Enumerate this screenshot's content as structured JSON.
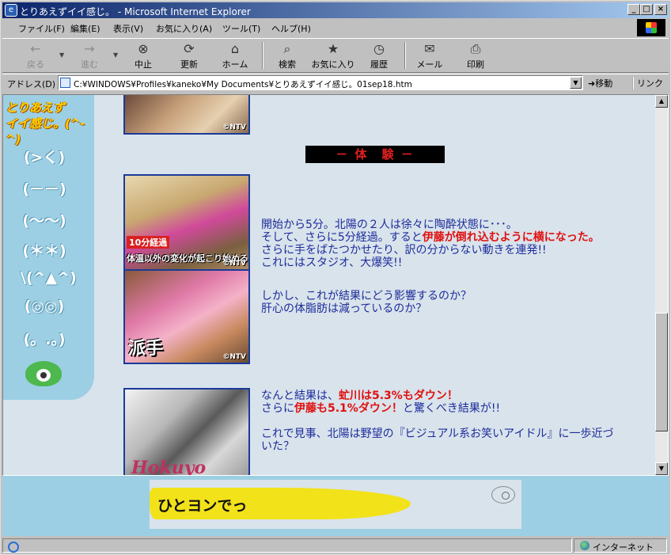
{
  "window": {
    "title": "とりあえずイイ感じ。 - Microsoft Internet Explorer",
    "controls": {
      "minimize": "_",
      "maximize": "□",
      "close": "×"
    }
  },
  "menu": [
    "ファイル(F)",
    "編集(E)",
    "表示(V)",
    "お気に入り(A)",
    "ツール(T)",
    "ヘルプ(H)"
  ],
  "toolbar": {
    "back": "戻る",
    "forward": "進む",
    "stop": "中止",
    "refresh": "更新",
    "home": "ホーム",
    "search": "検索",
    "favorites": "お気に入り",
    "history": "履歴",
    "mail": "メール",
    "print": "印刷"
  },
  "address": {
    "label": "アドレス(D)",
    "url": "C:¥WINDOWS¥Profiles¥kaneko¥My Documents¥とりあえずイイ感じ。01sep18.htm",
    "go": "移動",
    "links": "リンク"
  },
  "sidebar": {
    "logo_line1": "とりあえず",
    "logo_line2": "イイ感じ。(^-^)",
    "faces": [
      "(>く)",
      "(－－)",
      "(～～)",
      "(＊＊)",
      "\\(^▲^)",
      "(◎◎)",
      "(。.。)"
    ]
  },
  "content": {
    "section_title": "－ 体　験 －",
    "ntv": "©NTV",
    "photo1_caption1": "10分経過",
    "photo1_caption2": "体温以外の変化が起こり始める",
    "photo2_caption": "派手",
    "photo3_caption": "Hokuyo",
    "para1": {
      "line1": "開始から5分。北陽の２人は徐々に陶酔状態に･･･。",
      "line2_a": "そして、さらに5分経過。すると",
      "line2_b": "伊藤が倒れ込むように横になった。",
      "line3": "さらに手をばたつかせたり、訳の分からない動きを連発!!",
      "line4": "これにはスタジオ、大爆笑!!"
    },
    "para2": {
      "line1": "しかし、これが結果にどう影響するのか？",
      "line2": "肝心の体脂肪は減っているのか？"
    },
    "para3": {
      "line1_a": "なんと結果は、",
      "line1_b": "虻川は5.3%もダウン！",
      "line2_a": "さらに",
      "line2_b": "伊藤も5.1%ダウン！",
      "line2_c": "と驚くべき結果が!!",
      "line3": "これで見事、北陽は野望の『ビジュアル系お笑いアイドル』に一歩近づ",
      "line4": "いた？"
    }
  },
  "banner": {
    "text": "ひとヨンでっ"
  },
  "status": {
    "zone": "インターネット"
  },
  "icons": {
    "back": "←",
    "forward": "→",
    "stop": "⊗",
    "refresh": "⟳",
    "home": "⌂",
    "search": "⌕",
    "favorites": "★",
    "history": "◷",
    "mail": "✉",
    "print": "⎙"
  }
}
